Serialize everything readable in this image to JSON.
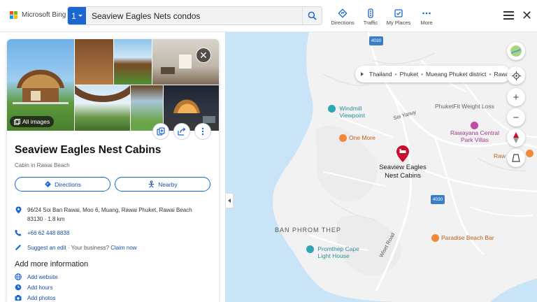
{
  "brand": {
    "name": "Microsoft Bing",
    "logo_colors": [
      "#f25022",
      "#7fba00",
      "#00a4ef",
      "#ffb900"
    ]
  },
  "search": {
    "result_count": "1",
    "query": "Seaview Eagles Nets condos"
  },
  "tools": [
    {
      "label": "Directions",
      "icon": "directions-icon"
    },
    {
      "label": "Traffic",
      "icon": "traffic-icon"
    },
    {
      "label": "My Places",
      "icon": "my-places-icon"
    },
    {
      "label": "More",
      "icon": "more-icon"
    }
  ],
  "breadcrumb": [
    "Thailand",
    "Phuket",
    "Mueang Phuket district",
    "Rawai"
  ],
  "map": {
    "roads": [
      "4030",
      "4030"
    ],
    "pois": [
      {
        "name": "Windmill Viewpoint",
        "type": "viewpoint"
      },
      {
        "name": "One More",
        "type": "restaurant"
      },
      {
        "name": "PhuketFit Weight Loss",
        "type": "business"
      },
      {
        "name": "Rawayana Central Park Villas",
        "type": "hotel"
      },
      {
        "name": "Raw",
        "type": "restaurant"
      },
      {
        "name": "Promthep Cape Light House",
        "type": "viewpoint"
      },
      {
        "name": "Paradise Beach Bar",
        "type": "restaurant"
      }
    ],
    "street_labels": [
      "Soi Yanuy",
      "Wiset Road"
    ],
    "area_label": "BAN PHROM THEP",
    "selected_pin": {
      "line1": "Seaview Eagles",
      "line2": "Nest Cabins"
    },
    "colors": {
      "water": "#c9e4f7",
      "land": "#f2f2f2",
      "road": "#ffffff",
      "pin": "#c8102e"
    }
  },
  "place": {
    "all_images_label": "All images",
    "title": "Seaview Eagles Nest Cabins",
    "category": "Cabin in Rawai Beach",
    "directions_label": "Directions",
    "nearby_label": "Nearby",
    "address_line1": "96/24 Soi Ban Rawai, Moo 6, Muang, Rawai Phuket, Rawai Beach",
    "address_line2": "83130 · 1.8 km",
    "phone": "+66 62 448 8838",
    "suggest_edit": "Suggest an edit",
    "your_business": "· Your business?",
    "claim_now": "Claim now",
    "more_info_heading": "Add more information",
    "add_website": "Add website",
    "add_hours": "Add hours",
    "add_photos": "Add photos"
  }
}
